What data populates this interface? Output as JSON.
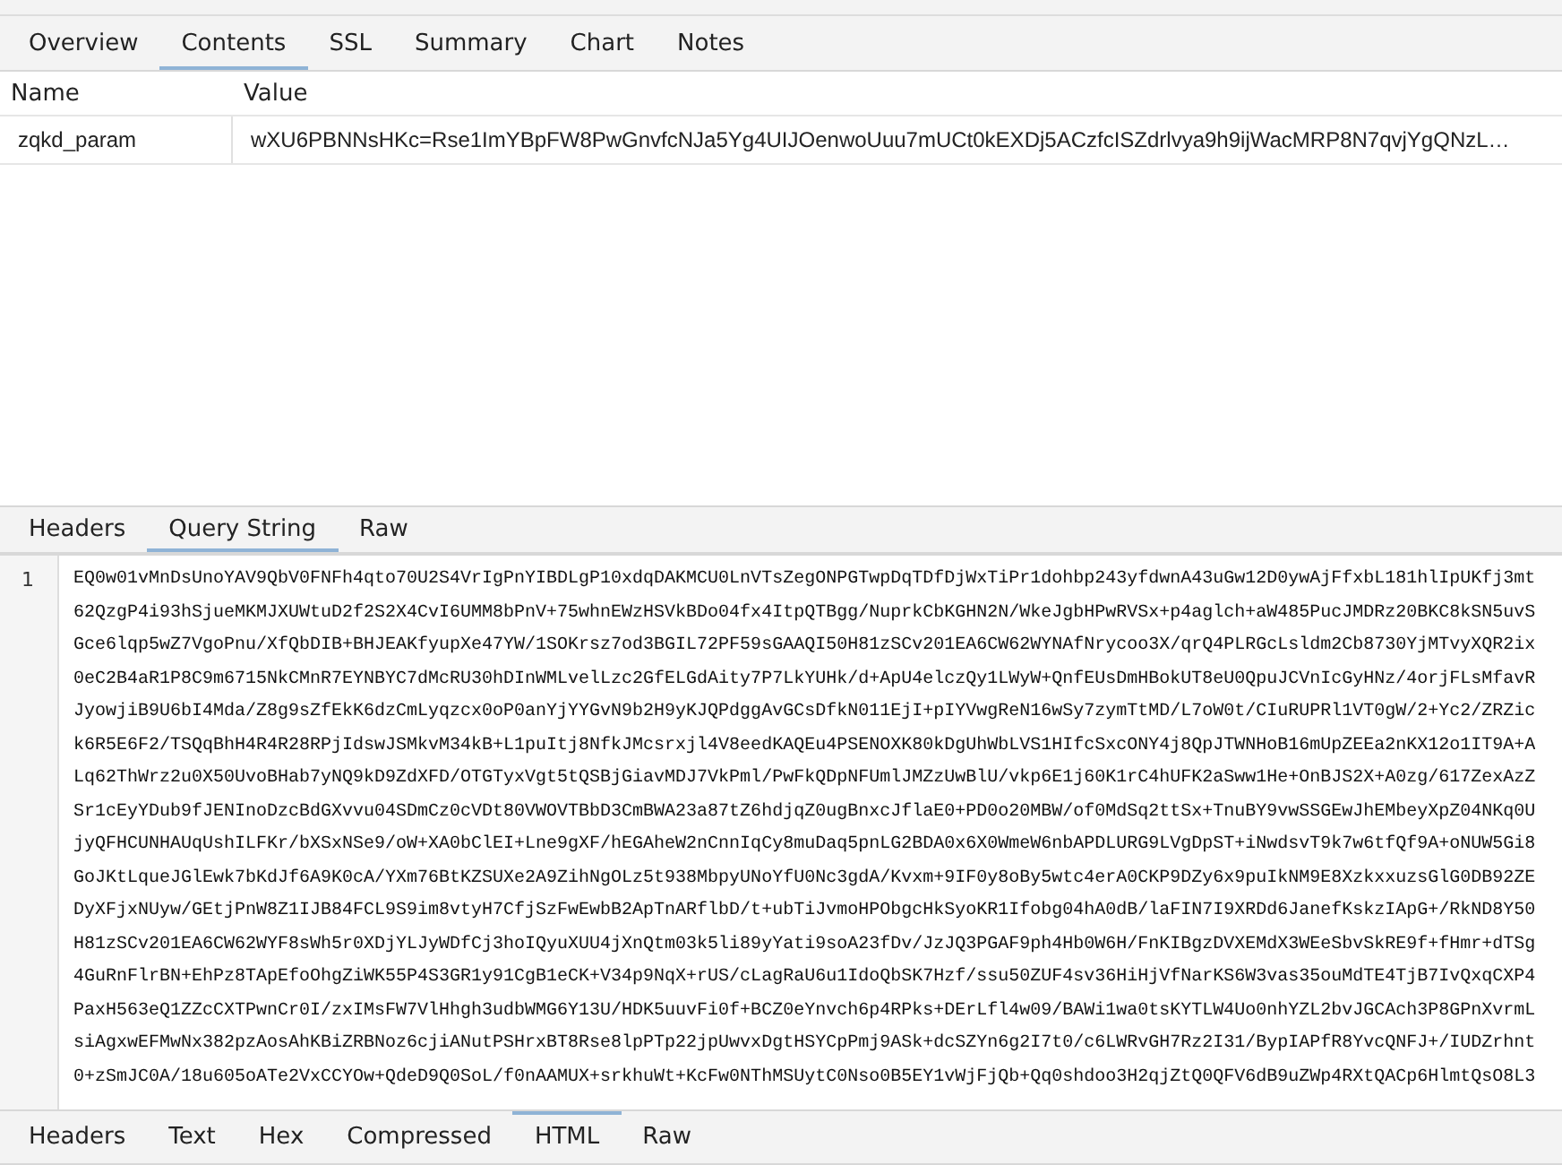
{
  "top_tabs": [
    {
      "label": "Overview",
      "selected": false
    },
    {
      "label": "Contents",
      "selected": true
    },
    {
      "label": "SSL",
      "selected": false
    },
    {
      "label": "Summary",
      "selected": false
    },
    {
      "label": "Chart",
      "selected": false
    },
    {
      "label": "Notes",
      "selected": false
    }
  ],
  "params_table": {
    "columns": [
      "Name",
      "Value"
    ],
    "rows": [
      {
        "name": "zqkd_param",
        "value": "wXU6PBNNsHKc=Rse1ImYBpFW8PwGnvfcNJa5Yg4UIJOenwoUuu7mUCt0kEXDj5ACzfcISZdrlvya9h9ijWacMRP8N7qvjYgQNzL…"
      }
    ]
  },
  "request_tabs": [
    {
      "label": "Headers",
      "selected": false
    },
    {
      "label": "Query String",
      "selected": true
    },
    {
      "label": "Raw",
      "selected": false
    }
  ],
  "code": {
    "line_number": "1",
    "lines": [
      "EQ0w01vMnDsUnoYAV9QbV0FNFh4qto70U2S4VrIgPnYIBDLgP10xdqDAKMCU0LnVTsZegONPGTwpDqTDfDjWxTiPr1dohbp243yfdwnA43uGw12D0ywAjFfxbL181hlIpUKfj3mt",
      "62QzgP4i93hSjueMKMJXUWtuD2f2S2X4CvI6UMM8bPnV+75whnEWzHSVkBDo04fx4ItpQTBgg/NuprkCbKGHN2N/WkeJgbHPwRVSx+p4aglch+aW485PucJMDRz20BKC8kSN5uvS",
      "Gce6lqp5wZ7VgoPnu/XfQbDIB+BHJEAKfyupXe47YW/1SOKrsz7od3BGIL72PF59sGAAQI50H81zSCv201EA6CW62WYNAfNrycoo3X/qrQ4PLRGcLsldm2Cb8730YjMTvyXQR2ix",
      "0eC2B4aR1P8C9m6715NkCMnR7EYNBYC7dMcRU30hDInWMLvelLzc2GfELGdAity7P7LkYUHk/d+ApU4elczQy1LWyW+QnfEUsDmHBokUT8eU0QpuJCVnIcGyHNz/4orjFLsMfavR",
      "JyowjiB9U6bI4Mda/Z8g9sZfEkK6dzCmLyqzcx0oP0anYjYYGvN9b2H9yKJQPdggAvGCsDfkN011EjI+pIYVwgReN16wSy7zymTtMD/L7oW0t/CIuRUPRl1VT0gW/2+Yc2/ZRZic",
      "k6R5E6F2/TSQqBhH4R4R28RPjIdswJSMkvM34kB+L1puItj8NfkJMcsrxjl4V8eedKAQEu4PSENOXK80kDgUhWbLVS1HIfcSxcONY4j8QpJTWNHoB16mUpZEEa2nKX12o1IT9A+A",
      "Lq62ThWrz2u0X50UvoBHab7yNQ9kD9ZdXFD/OTGTyxVgt5tQSBjGiavMDJ7VkPml/PwFkQDpNFUmlJMZzUwBlU/vkp6E1j60K1rC4hUFK2aSww1He+OnBJS2X+A0zg/617ZexAzZ",
      "Sr1cEyYDub9fJENInoDzcBdGXvvu04SDmCz0cVDt80VWOVTBbD3CmBWA23a87tZ6hdjqZ0ugBnxcJflaE0+PD0o20MBW/of0MdSq2ttSx+TnuBY9vwSSGEwJhEMbeyXpZ04NKq0U",
      "jyQFHCUNHAUqUshILFKr/bXSxNSe9/oW+XA0bClEI+Lne9gXF/hEGAheW2nCnnIqCy8muDaq5pnLG2BDA0x6X0WmeW6nbAPDLURG9LVgDpST+iNwdsvT9k7w6tfQf9A+oNUW5Gi8",
      "GoJKtLqueJGlEwk7bKdJf6A9K0cA/YXm76BtKZSUXe2A9ZihNgOLz5t938MbpyUNoYfU0Nc3gdA/Kvxm+9IF0y8oBy5wtc4erA0CKP9DZy6x9puIkNM9E8XzkxxuzsGlG0DB92ZE",
      "DyXFjxNUyw/GEtjPnW8Z1IJB84FCL9S9im8vtyH7CfjSzFwEwbB2ApTnARflbD/t+ubTiJvmoHPObgcHkSyoKR1Ifobg04hA0dB/laFIN7I9XRDd6JanefKskzIApG+/RkND8Y50",
      "H81zSCv201EA6CW62WYF8sWh5r0XDjYLJyWDfCj3hoIQyuXUU4jXnQtm03k5li89yYati9soA23fDv/JzJQ3PGAF9ph4Hb0W6H/FnKIBgzDVXEMdX3WEeSbvSkRE9f+fHmr+dTSg",
      "4GuRnFlrBN+EhPz8TApEfoOhgZiWK55P4S3GR1y91CgB1eCK+V34p9NqX+rUS/cLagRaU6u1IdoQbSK7Hzf/ssu50ZUF4sv36HiHjVfNarKS6W3vas35ouMdTE4TjB7IvQxqCXP4",
      "PaxH563eQ1ZZcCXTPwnCr0I/zxIMsFW7VlHhgh3udbWMG6Y13U/HDK5uuvFi0f+BCZ0eYnvch6p4RPks+DErLfl4w09/BAWi1wa0tsKYTLW4Uo0nhYZL2bvJGCAch3P8GPnXvrmL",
      "siAgxwEFMwNx382pzAosAhKBiZRBNoz6cjiANutPSHrxBT8Rse8lpPTp22jpUwvxDgtHSYCpPmj9ASk+dcSZYn6g2I7t0/c6LWRvGH7Rz2I31/BypIAPfR8YvcQNFJ+/IUDZrhnt",
      "0+zSmJC0A/18u605oATe2VxCCYOw+QdeD9Q0SoL/f0nAAMUX+srkhuWt+KcFw0NThMSUytC0Nso0B5EY1vWjFjQb+Qq0shdoo3H2qjZtQ0QFV6dB9uZWp4RXtQACp6HlmtQsO8L3"
    ]
  },
  "response_tabs": [
    {
      "label": "Headers",
      "selected": false
    },
    {
      "label": "Text",
      "selected": false
    },
    {
      "label": "Hex",
      "selected": false
    },
    {
      "label": "Compressed",
      "selected": false
    },
    {
      "label": "HTML",
      "selected": true
    },
    {
      "label": "Raw",
      "selected": false
    }
  ]
}
